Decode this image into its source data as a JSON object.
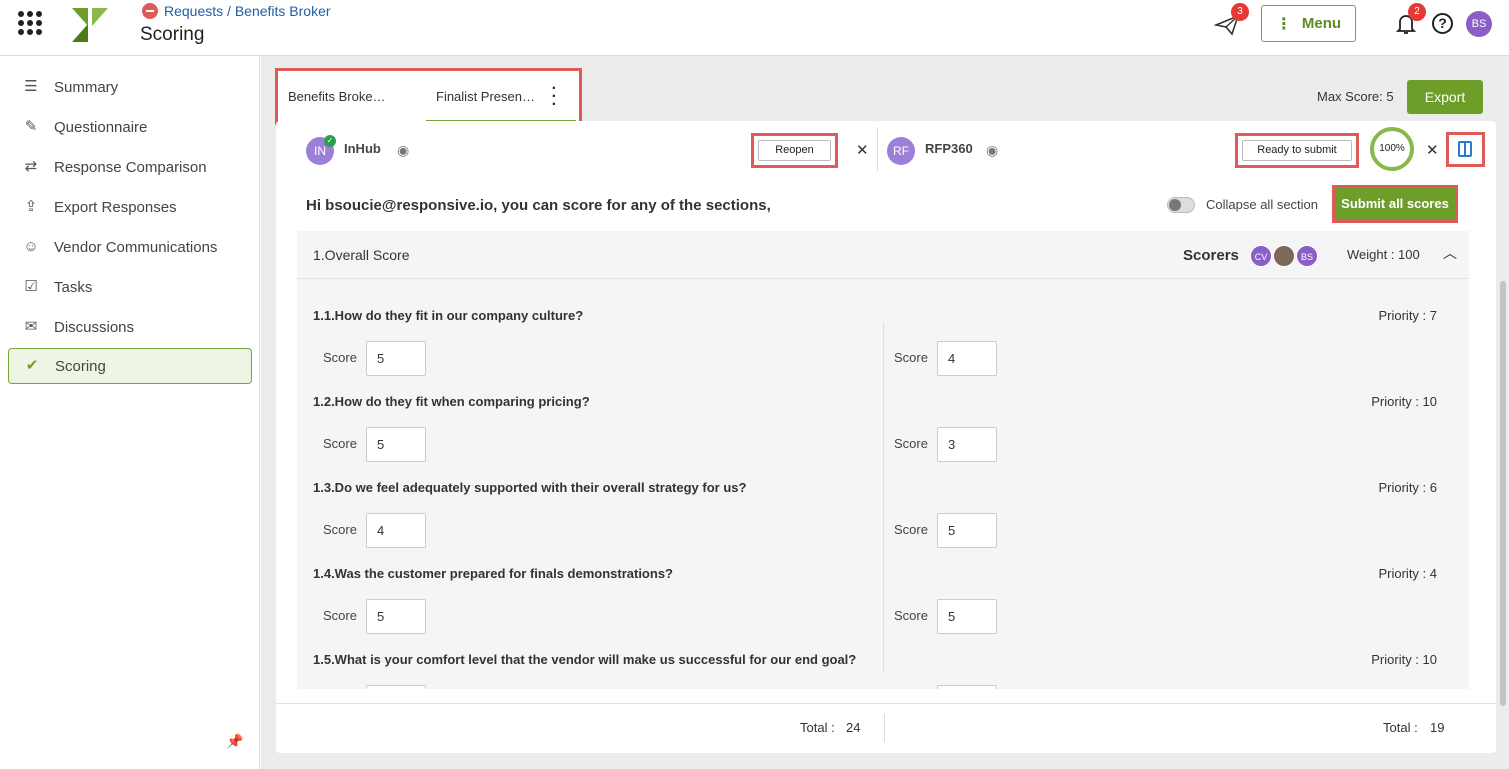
{
  "header": {
    "breadcrumb": "Requests / Benefits Broker",
    "title": "Scoring",
    "send_badge": "3",
    "menu_label": "Menu",
    "bell_badge": "2",
    "help_glyph": "?",
    "user_initials": "BS"
  },
  "sidebar": {
    "items": [
      {
        "label": "Summary",
        "icon": "list-icon"
      },
      {
        "label": "Questionnaire",
        "icon": "edit-icon"
      },
      {
        "label": "Response Comparison",
        "icon": "compare-icon"
      },
      {
        "label": "Export Responses",
        "icon": "upload-icon"
      },
      {
        "label": "Vendor Communications",
        "icon": "people-icon"
      },
      {
        "label": "Tasks",
        "icon": "calendar-check-icon"
      },
      {
        "label": "Discussions",
        "icon": "chat-icon"
      },
      {
        "label": "Scoring",
        "icon": "scoring-icon"
      }
    ],
    "active": "Scoring"
  },
  "tabs": [
    {
      "label": "Benefits Broke…"
    },
    {
      "label": "Finalist Presen…"
    }
  ],
  "toolbar": {
    "max_score": "Max Score: 5",
    "export": "Export"
  },
  "vendors": [
    {
      "initials": "IN",
      "name": "InHub",
      "action": "Reopen"
    },
    {
      "initials": "RF",
      "name": "RFP360",
      "action": "Ready to submit",
      "progress": "100%"
    }
  ],
  "greeting": "Hi bsoucie@responsive.io, you can score for any of the sections,",
  "collapse_label": "Collapse all section",
  "submit_all": "Submit all scores",
  "section": {
    "title": "1.Overall Score",
    "scorers_label": "Scorers",
    "scorers": [
      "CV",
      "",
      "BS"
    ],
    "weight": "Weight : 100"
  },
  "questions": [
    {
      "text": "1.1.How do they fit in our company culture?",
      "priority": "Priority : 7",
      "score_a": "5",
      "score_b": "4"
    },
    {
      "text": "1.2.How do they fit when comparing pricing?",
      "priority": "Priority : 10",
      "score_a": "5",
      "score_b": "3"
    },
    {
      "text": "1.3.Do we feel adequately supported with their overall strategy for us?",
      "priority": "Priority : 6",
      "score_a": "4",
      "score_b": "5"
    },
    {
      "text": "1.4.Was the customer prepared for finals demonstrations?",
      "priority": "Priority : 4",
      "score_a": "5",
      "score_b": "5"
    },
    {
      "text": "1.5.What is your comfort level that the vendor will make us successful for our end goal?",
      "priority": "Priority : 10",
      "score_a": "",
      "score_b": ""
    }
  ],
  "score_label": "Score",
  "totals": {
    "a_label": "Total :",
    "a_value": "24",
    "b_label": "Total :",
    "b_value": "19"
  },
  "colors": {
    "accent_green": "#6e9e2a",
    "highlight_red": "#e05a5a",
    "avatar_purple": "#8a5fc8"
  }
}
